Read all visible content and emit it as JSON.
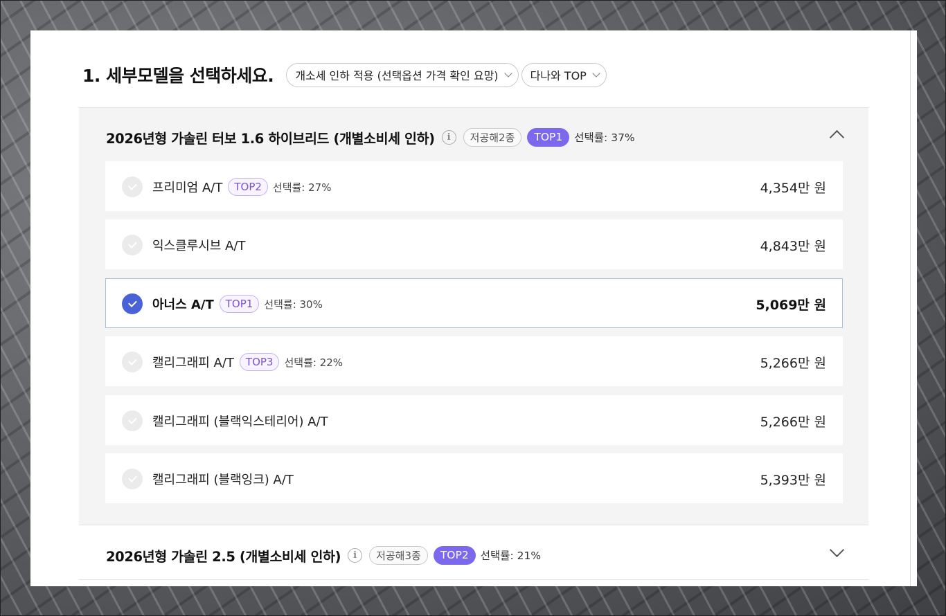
{
  "section": {
    "title": "1. 세부모델을 선택하세요.",
    "filter_dropdown": "개소세 인하 적용 (선택옵션 가격 확인 요망)",
    "sort_dropdown": "다나와 TOP"
  },
  "groups": [
    {
      "title": "2026년형 가솔린 터보 1.6 하이브리드 (개별소비세 인하)",
      "info_icon": "i",
      "low_emission_tag": "저공해2종",
      "top_tag": "TOP1",
      "rate": "선택률: 37%",
      "expanded": true,
      "trims": [
        {
          "name": "프리미엄 A/T",
          "top": "TOP2",
          "rate": "선택률: 27%",
          "price": "4,354만 원",
          "selected": false
        },
        {
          "name": "익스클루시브 A/T",
          "top": "",
          "rate": "",
          "price": "4,843만 원",
          "selected": false
        },
        {
          "name": "아너스 A/T",
          "top": "TOP1",
          "rate": "선택률: 30%",
          "price": "5,069만 원",
          "selected": true
        },
        {
          "name": "캘리그래피 A/T",
          "top": "TOP3",
          "rate": "선택률: 22%",
          "price": "5,266만 원",
          "selected": false
        },
        {
          "name": "캘리그래피 (블랙익스테리어) A/T",
          "top": "",
          "rate": "",
          "price": "5,266만 원",
          "selected": false
        },
        {
          "name": "캘리그래피 (블랙잉크) A/T",
          "top": "",
          "rate": "",
          "price": "5,393만 원",
          "selected": false
        }
      ]
    },
    {
      "title": "2026년형 가솔린 2.5 (개별소비세 인하)",
      "info_icon": "i",
      "low_emission_tag": "저공해3종",
      "top_tag": "TOP2",
      "rate": "선택률: 21%",
      "expanded": false
    }
  ],
  "colors": {
    "accent_purple": "#7b68ee",
    "check_selected": "#4a62d8"
  }
}
